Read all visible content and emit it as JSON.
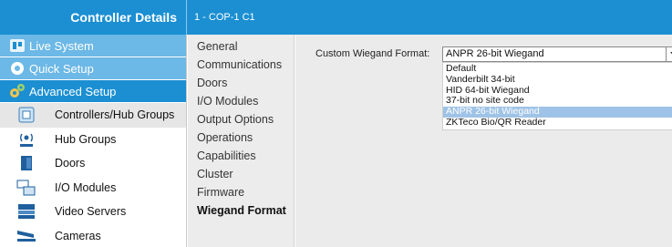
{
  "header": {
    "title": "Controller Details",
    "crumb": "1 - COP-1 C1"
  },
  "sidebar": {
    "top": [
      {
        "label": "Live System",
        "icon": "live-system-icon"
      },
      {
        "label": "Quick Setup",
        "icon": "gear-icon"
      },
      {
        "label": "Advanced Setup",
        "icon": "gears-icon"
      }
    ],
    "items": [
      {
        "label": "Controllers/Hub Groups",
        "icon": "controller-icon"
      },
      {
        "label": "Hub Groups",
        "icon": "hub-icon"
      },
      {
        "label": "Doors",
        "icon": "door-icon"
      },
      {
        "label": "I/O Modules",
        "icon": "io-module-icon"
      },
      {
        "label": "Video Servers",
        "icon": "video-server-icon"
      },
      {
        "label": "Cameras",
        "icon": "camera-icon"
      }
    ]
  },
  "menu": {
    "items": [
      "General",
      "Communications",
      "Doors",
      "I/O Modules",
      "Output Options",
      "Operations",
      "Capabilities",
      "Cluster",
      "Firmware",
      "Wiegand Format"
    ]
  },
  "form": {
    "label": "Custom Wiegand Format:",
    "value": "ANPR 26-bit Wiegand",
    "options": [
      "Default",
      "Vanderbilt 34-bit",
      "HID 64-bit Wiegand",
      "37-bit no site code",
      "ANPR 26-bit Wiegand",
      "ZKTeco Bio/QR Reader"
    ]
  },
  "colors": {
    "header": "#1b8fd2",
    "sidebar_light": "#6cb8e6",
    "selection": "#9fc3e6"
  }
}
